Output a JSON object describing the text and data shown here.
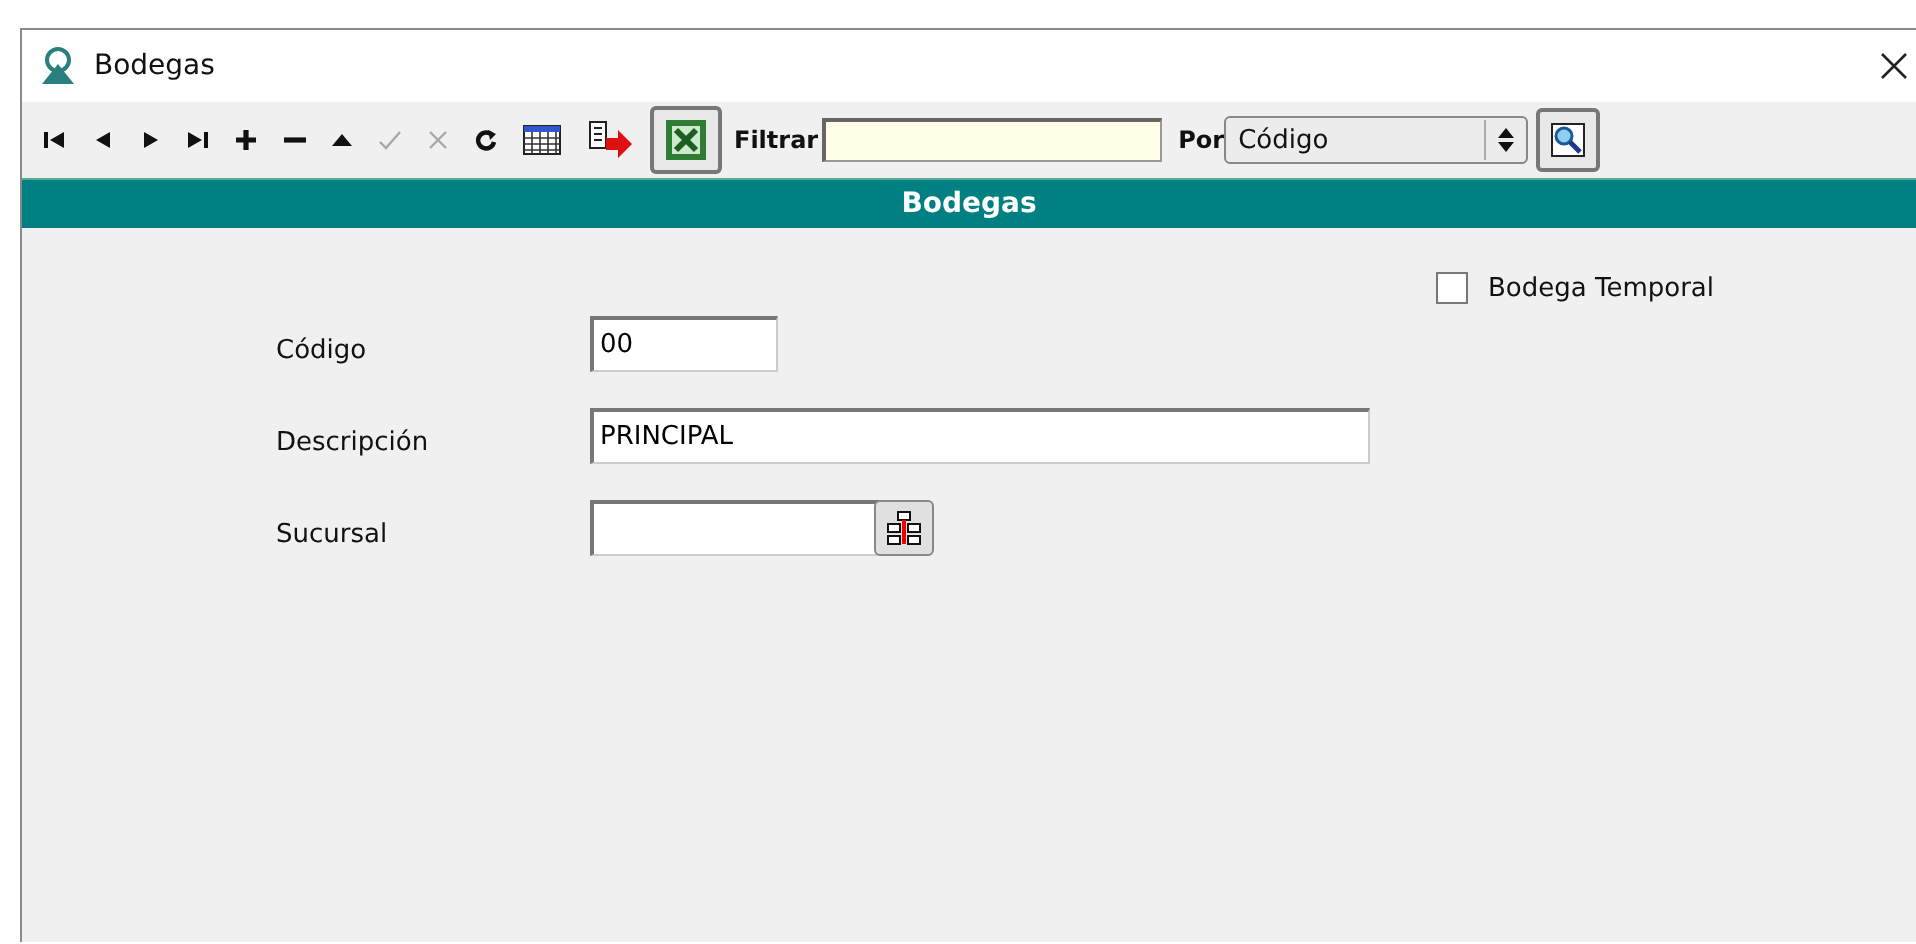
{
  "window": {
    "title": "Bodegas"
  },
  "toolbar": [
    {
      "kind": "first",
      "disabled": false
    },
    {
      "kind": "prev",
      "disabled": false
    },
    {
      "kind": "next",
      "disabled": false
    },
    {
      "kind": "last",
      "disabled": false
    },
    {
      "kind": "add",
      "disabled": false
    },
    {
      "kind": "remove",
      "disabled": false
    },
    {
      "kind": "up",
      "disabled": false
    },
    {
      "kind": "confirm",
      "disabled": true
    },
    {
      "kind": "cancel",
      "disabled": true
    },
    {
      "kind": "refresh",
      "disabled": false
    },
    {
      "kind": "grid",
      "disabled": false
    },
    {
      "kind": "export",
      "disabled": false
    },
    {
      "kind": "excel",
      "disabled": false
    }
  ],
  "filter": {
    "label": "Filtrar"
  },
  "by": {
    "label": "Por",
    "value": "Código"
  },
  "header": "Bodegas",
  "fields": [
    {
      "label": "Código",
      "value": "00",
      "kind": "text"
    },
    {
      "label": "Descripción",
      "value": "PRINCIPAL",
      "kind": "text"
    },
    {
      "label": "Sucursal",
      "kind": "lookup"
    }
  ],
  "temporal": {
    "label": "Bodega Temporal",
    "checked": false
  }
}
